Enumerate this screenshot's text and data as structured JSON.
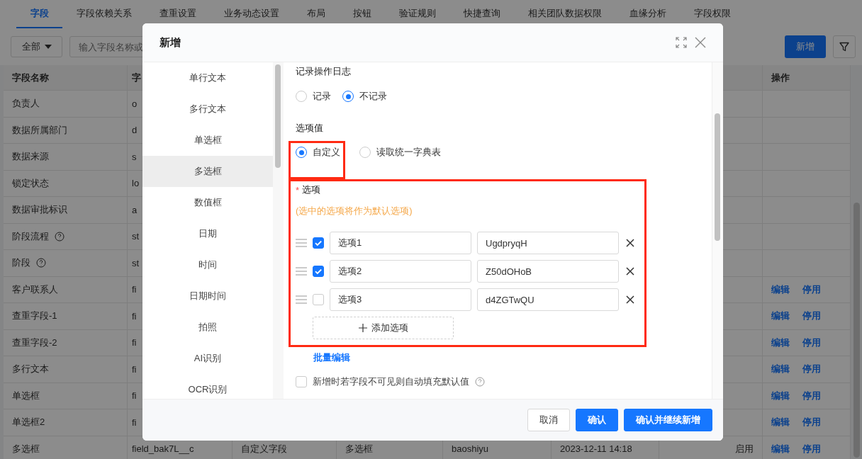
{
  "tabs": [
    {
      "label": "字段",
      "selected": true
    },
    {
      "label": "字段依赖关系",
      "selected": false
    },
    {
      "label": "查重设置",
      "selected": false
    },
    {
      "label": "业务动态设置",
      "selected": false
    },
    {
      "label": "布局",
      "selected": false
    },
    {
      "label": "按钮",
      "selected": false
    },
    {
      "label": "验证规则",
      "selected": false
    },
    {
      "label": "快捷查询",
      "selected": false
    },
    {
      "label": "相关团队数据权限",
      "selected": false
    },
    {
      "label": "血缘分析",
      "selected": false
    },
    {
      "label": "字段权限",
      "selected": false
    }
  ],
  "toolbar": {
    "filter": "全部",
    "search_placeholder": "输入字段名称或",
    "new_button": "新增"
  },
  "table": {
    "header": {
      "column_1": "字段名称",
      "column_2": "字",
      "actions": "操作"
    },
    "rows": [
      {
        "cells": [
          "负责人",
          "o"
        ],
        "help": false,
        "actions": []
      },
      {
        "cells": [
          "数据所属部门",
          "d"
        ],
        "help": false,
        "actions": []
      },
      {
        "cells": [
          "数据来源",
          "s"
        ],
        "help": false,
        "actions": []
      },
      {
        "cells": [
          "锁定状态",
          "lo"
        ],
        "help": false,
        "actions": []
      },
      {
        "cells": [
          "数据审批标识",
          "a"
        ],
        "help": false,
        "actions": []
      },
      {
        "cells": [
          "阶段流程",
          "st"
        ],
        "help": true,
        "actions": []
      },
      {
        "cells": [
          "阶段",
          "st"
        ],
        "help": true,
        "actions": []
      },
      {
        "cells": [
          "客户联系人",
          "fi"
        ],
        "help": false,
        "actions": [
          "编辑",
          "停用"
        ]
      },
      {
        "cells": [
          "查重字段-1",
          "fi"
        ],
        "help": false,
        "actions": [
          "编辑",
          "停用"
        ]
      },
      {
        "cells": [
          "查重字段-2",
          "fi"
        ],
        "help": false,
        "actions": [
          "编辑",
          "停用"
        ]
      },
      {
        "cells": [
          "多行文本",
          "fi"
        ],
        "help": false,
        "actions": [
          "编辑",
          "停用"
        ]
      },
      {
        "cells": [
          "单选框",
          "fi"
        ],
        "help": false,
        "actions": [
          "编辑",
          "停用"
        ]
      },
      {
        "cells": [
          "单选框2",
          "fi"
        ],
        "help": false,
        "actions": [
          "编辑",
          "停用"
        ]
      },
      {
        "cells": [
          "多选框",
          "field_bak7L__c",
          "自定义字段",
          "多选框",
          "baoshiyu",
          "2023-12-11 14:18",
          "启用"
        ],
        "help": false,
        "actions": [
          "编辑",
          "停用"
        ]
      }
    ]
  },
  "dialog": {
    "title": "新增",
    "field_types": [
      {
        "label": "单行文本",
        "selected": false
      },
      {
        "label": "多行文本",
        "selected": false
      },
      {
        "label": "单选框",
        "selected": false
      },
      {
        "label": "多选框",
        "selected": true
      },
      {
        "label": "数值框",
        "selected": false
      },
      {
        "label": "日期",
        "selected": false
      },
      {
        "label": "时间",
        "selected": false
      },
      {
        "label": "日期时间",
        "selected": false
      },
      {
        "label": "拍照",
        "selected": false
      },
      {
        "label": "AI识别",
        "selected": false
      },
      {
        "label": "OCR识别",
        "selected": false
      }
    ],
    "log": {
      "label": "记录操作日志",
      "options": [
        {
          "label": "记录",
          "selected": false
        },
        {
          "label": "不记录",
          "selected": true
        }
      ]
    },
    "option_source": {
      "label": "选项值",
      "options": [
        {
          "label": "自定义",
          "selected": true,
          "highlighted": true
        },
        {
          "label": "读取统一字典表",
          "selected": false,
          "highlighted": false
        }
      ]
    },
    "options_section": {
      "label": "选项",
      "required_mark": "*",
      "highlighted": true,
      "hint": "(选中的选项将作为默认选项)",
      "items": [
        {
          "checked": true,
          "label": "选项1",
          "value": "UgdpryqH"
        },
        {
          "checked": true,
          "label": "选项2",
          "value": "Z50dOHoB"
        },
        {
          "checked": false,
          "label": "选项3",
          "value": "d4ZGTwQU"
        }
      ],
      "add_button": "添加选项"
    },
    "bulk_edit": "批量编辑",
    "autofill": {
      "checked": false,
      "label": "新增时若字段不可见则自动填充默认值"
    },
    "buttons": [
      {
        "label": "取消",
        "kind": "default"
      },
      {
        "label": "确认",
        "kind": "primary"
      },
      {
        "label": "确认并继续新增",
        "kind": "primary"
      }
    ]
  }
}
